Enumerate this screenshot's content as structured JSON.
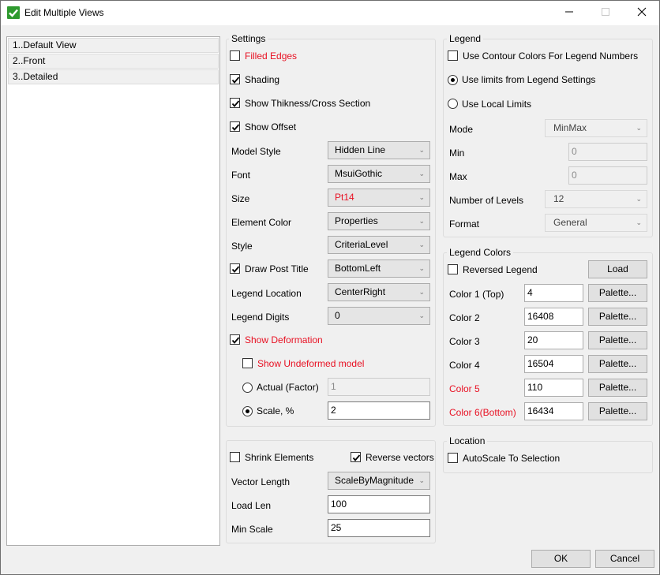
{
  "window": {
    "title": "Edit Multiple Views",
    "accent_color": "#2e9a2e",
    "controls": {
      "minimize": "minimize-icon",
      "maximize": "maximize-icon",
      "close": "close-icon"
    }
  },
  "views": [
    {
      "label": "1..Default View"
    },
    {
      "label": "2..Front"
    },
    {
      "label": "3..Detailed"
    }
  ],
  "settings": {
    "title": "Settings",
    "filled_edges": {
      "label": "Filled Edges",
      "checked": false
    },
    "shading": {
      "label": "Shading",
      "checked": true
    },
    "show_thickness": {
      "label": "Show Thikness/Cross Section",
      "checked": true
    },
    "show_offset": {
      "label": "Show Offset",
      "checked": true
    },
    "model_style": {
      "label": "Model Style",
      "value": "Hidden Line"
    },
    "font": {
      "label": "Font",
      "value": "MsuiGothic"
    },
    "size": {
      "label": "Size",
      "value": "Pt14"
    },
    "element_color": {
      "label": "Element Color",
      "value": "Properties"
    },
    "style": {
      "label": "Style",
      "value": "CriteriaLevel"
    },
    "draw_post_title": {
      "label": "Draw Post Title",
      "checked": true,
      "value": "BottomLeft"
    },
    "legend_location": {
      "label": "Legend Location",
      "value": "CenterRight"
    },
    "legend_digits": {
      "label": "Legend Digits",
      "value": "0"
    },
    "show_deformation": {
      "label": "Show Deformation",
      "checked": true
    },
    "show_undeformed": {
      "label": "Show Undeformed model",
      "checked": false
    },
    "actual_factor": {
      "label": "Actual (Factor)",
      "selected": false,
      "value": "1"
    },
    "scale_percent": {
      "label": "Scale, %",
      "selected": true,
      "value": "2"
    }
  },
  "vectors": {
    "shrink_elements": {
      "label": "Shrink Elements",
      "checked": false
    },
    "reverse_vectors": {
      "label": "Reverse vectors",
      "checked": true
    },
    "vector_length": {
      "label": "Vector Length",
      "value": "ScaleByMagnitude"
    },
    "load_len": {
      "label": "Load Len",
      "value": "100"
    },
    "min_scale": {
      "label": "Min Scale",
      "value": "25"
    }
  },
  "legend": {
    "title": "Legend",
    "use_contour_colors": {
      "label": "Use Contour Colors For Legend Numbers",
      "checked": false
    },
    "use_limits_from_settings": {
      "label": "Use limits from Legend Settings",
      "selected": true
    },
    "use_local_limits": {
      "label": "Use Local Limits",
      "selected": false
    },
    "mode": {
      "label": "Mode",
      "value": "MinMax"
    },
    "min": {
      "label": "Min",
      "value": "0"
    },
    "max": {
      "label": "Max",
      "value": "0"
    },
    "levels": {
      "label": "Number of Levels",
      "value": "12"
    },
    "format": {
      "label": "Format",
      "value": "General"
    }
  },
  "legend_colors": {
    "title": "Legend Colors",
    "reversed": {
      "label": "Reversed Legend",
      "checked": false
    },
    "load_label": "Load",
    "palette_label": "Palette...",
    "colors": [
      {
        "label": "Color 1 (Top)",
        "value": "4",
        "highlight": false
      },
      {
        "label": "Color 2",
        "value": "16408",
        "highlight": false
      },
      {
        "label": "Color 3",
        "value": "20",
        "highlight": false
      },
      {
        "label": "Color 4",
        "value": "16504",
        "highlight": false
      },
      {
        "label": "Color 5",
        "value": "110",
        "highlight": true
      },
      {
        "label": "Color 6(Bottom)",
        "value": "16434",
        "highlight": true
      }
    ]
  },
  "location": {
    "title": "Location",
    "autoscale": {
      "label": "AutoScale To Selection",
      "checked": false
    }
  },
  "footer": {
    "ok_label": "OK",
    "cancel_label": "Cancel"
  }
}
